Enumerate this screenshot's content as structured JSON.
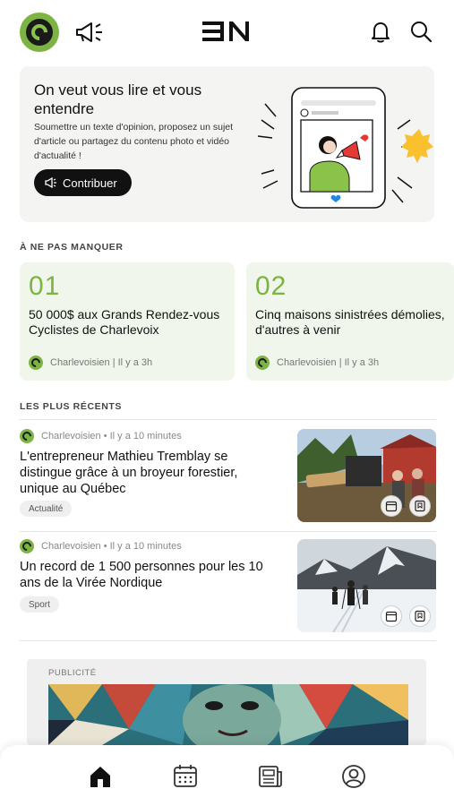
{
  "header": {
    "profile_icon": "charlevoisien-logo-icon",
    "megaphone_icon": "megaphone-icon",
    "logo_text": "EN",
    "notifications_icon": "bell-icon",
    "search_icon": "search-icon"
  },
  "promo": {
    "title": "On veut vous lire et vous entendre",
    "text": "Soumettre un texte d'opinion, proposez un sujet d'article ou partagez du contenu photo et vidéo d'actualité !",
    "button_label": "Contribuer",
    "illustration": "phone-megaphone-illustration"
  },
  "must_see": {
    "section_title": "À NE PAS MANQUER",
    "items": [
      {
        "number": "01",
        "title": "50 000$ aux Grands Rendez-vous Cyclistes de Charlevoix",
        "meta": "Charlevoisien | Il y a 3h"
      },
      {
        "number": "02",
        "title": "Cinq maisons sinistrées démolies, d'autres à venir",
        "meta": "Charlevoisien | Il y a 3h"
      }
    ]
  },
  "recent": {
    "section_title": "LES PLUS RÉCENTS",
    "items": [
      {
        "meta": "Charlevoisien • Il y a 10 minutes",
        "title": "L'entrepreneur Mathieu Tremblay se distingue grâce à un broyeur forestier, unique au Québec",
        "tag": "Actualité"
      },
      {
        "meta": "Charlevoisien • Il y a 10 minutes",
        "title": "Un record de 1 500 personnes pour les 10 ans de la Virée Nordique",
        "tag": "Sport"
      }
    ]
  },
  "ad": {
    "label": "PUBLICITÉ"
  },
  "bottom_nav": {
    "items": [
      "home-icon",
      "calendar-icon",
      "newspaper-icon",
      "profile-icon"
    ],
    "active": "home-icon"
  },
  "colors": {
    "accent": "#7cb342",
    "card_bg": "#f1f6ec",
    "promo_bg": "#f4f4f3",
    "dark": "#111111"
  }
}
